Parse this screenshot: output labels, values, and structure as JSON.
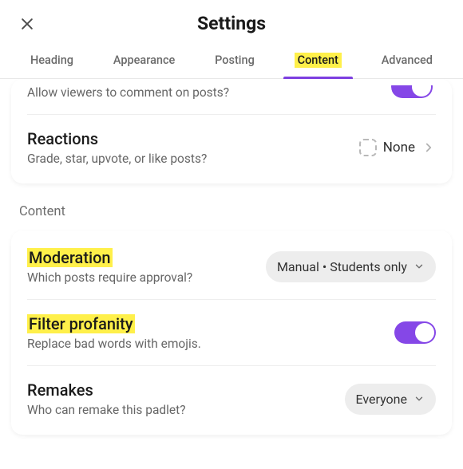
{
  "title": "Settings",
  "tabs": [
    "Heading",
    "Appearance",
    "Posting",
    "Content",
    "Advanced"
  ],
  "activeTab": 3,
  "commentsRow": {
    "desc": "Allow viewers to comment on posts?"
  },
  "reactions": {
    "title": "Reactions",
    "desc": "Grade, star, upvote, or like posts?",
    "value": "None"
  },
  "contentLabel": "Content",
  "moderation": {
    "title": "Moderation",
    "desc": "Which posts require approval?",
    "value": "Manual • Students only"
  },
  "filter": {
    "title": "Filter profanity",
    "desc": "Replace bad words with emojis."
  },
  "remakes": {
    "title": "Remakes",
    "desc": "Who can remake this padlet?",
    "value": "Everyone"
  }
}
